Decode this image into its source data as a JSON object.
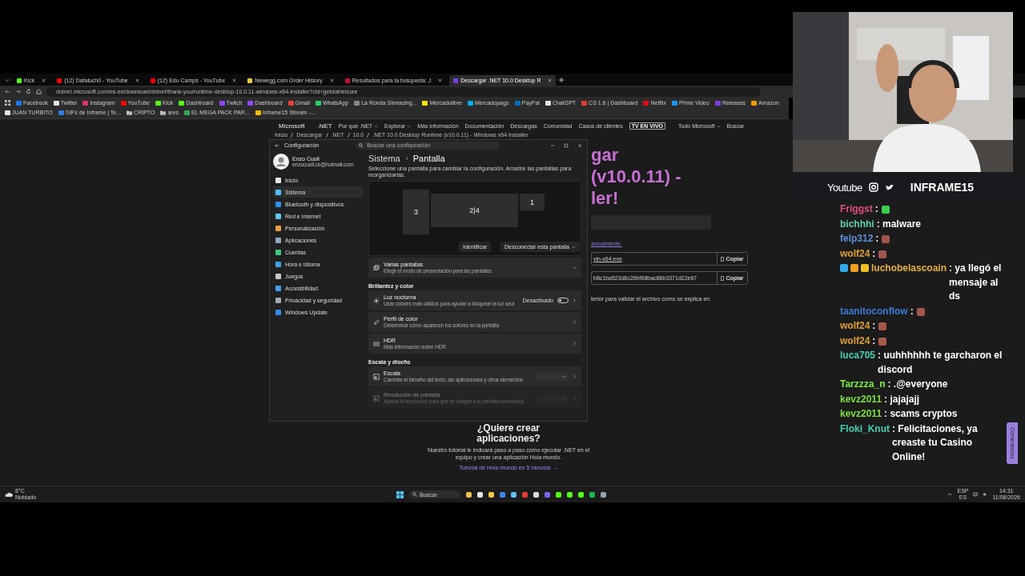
{
  "browser": {
    "tabs": [
      {
        "label": "Kick",
        "color": "#53fc18",
        "selected": false
      },
      {
        "label": "(12) Dafaluch0 - YouTube",
        "color": "#ff0000",
        "selected": false
      },
      {
        "label": "(12) Edu Camps - YouTube",
        "color": "#ff0000",
        "selected": false
      },
      {
        "label": "Newegg.com Order History",
        "color": "#f7c948",
        "selected": false
      },
      {
        "label": "Resultados para la búsqueda: J",
        "color": "#c8102e",
        "selected": false
      },
      {
        "label": "Descargar .NET 10.0 Desktop R",
        "color": "#7b3fe4",
        "selected": true
      }
    ],
    "url": "dotnet.microsoft.com/es-es/download/dotnet/thank-you/runtime-desktop-10.0.11-windows-x64-installer?cid=getdotnetcore",
    "bookmarks": [
      {
        "label": "Facebook",
        "kind": "site",
        "color": "#1877f2"
      },
      {
        "label": "Twitter",
        "kind": "site",
        "color": "#e6e6e6"
      },
      {
        "label": "Instagram",
        "kind": "site",
        "color": "#e1306c"
      },
      {
        "label": "YouTube",
        "kind": "site",
        "color": "#ff0000"
      },
      {
        "label": "Kick",
        "kind": "site",
        "color": "#53fc18"
      },
      {
        "label": "Dashboard",
        "kind": "site",
        "color": "#53fc18"
      },
      {
        "label": "Twitch",
        "kind": "site",
        "color": "#9146ff"
      },
      {
        "label": "Dashboard",
        "kind": "site",
        "color": "#9146ff"
      },
      {
        "label": "Gmail",
        "kind": "site",
        "color": "#ea4335"
      },
      {
        "label": "WhatsApp",
        "kind": "site",
        "color": "#25d366"
      },
      {
        "label": "La Ronda Simracing...",
        "kind": "site",
        "color": "#888888"
      },
      {
        "label": "Mercadolibre",
        "kind": "site",
        "color": "#ffe600"
      },
      {
        "label": "Mercadopago",
        "kind": "site",
        "color": "#00b1ea"
      },
      {
        "label": "PayPal",
        "kind": "site",
        "color": "#0070ba"
      },
      {
        "label": "ChatGPT",
        "kind": "site",
        "color": "#e6e6e6"
      },
      {
        "label": "CS 1.6 | Dashboard",
        "kind": "site",
        "color": "#e53935"
      },
      {
        "label": "Netflix",
        "kind": "site",
        "color": "#e50914"
      },
      {
        "label": "Prime Video",
        "kind": "site",
        "color": "#1a98ff"
      },
      {
        "label": "Releases",
        "kind": "site",
        "color": "#7b3fe4"
      },
      {
        "label": "Amazon",
        "kind": "site",
        "color": "#ff9900"
      },
      {
        "label": "JUAN TURBITO",
        "kind": "site",
        "color": "#e6e6e6"
      },
      {
        "label": "GIFs de Inframe | Te...",
        "kind": "site",
        "color": "#2b7de9"
      },
      {
        "label": "CRIPTO",
        "kind": "folder",
        "color": "#bbbbbb"
      },
      {
        "label": "ares",
        "kind": "folder",
        "color": "#bbbbbb"
      },
      {
        "label": "EL MEGA PACK PAR...",
        "kind": "site",
        "color": "#34a853"
      },
      {
        "label": "Inframe15 Stream -...",
        "kind": "site",
        "color": "#fbbc04"
      }
    ]
  },
  "page": {
    "brand": "Microsoft",
    "product": ".NET",
    "nav": [
      {
        "label": "Por qué .NET",
        "dropdown": true
      },
      {
        "label": "Explorar",
        "dropdown": true
      },
      {
        "label": "Más información",
        "dropdown": false
      },
      {
        "label": "Documentación",
        "dropdown": false
      },
      {
        "label": "Descargas",
        "dropdown": false
      },
      {
        "label": "Comunidad",
        "dropdown": false
      },
      {
        "label": "Casos de clientes",
        "dropdown": false
      }
    ],
    "live_button": "TV EN VIVO",
    "all_microsoft": "Todo Microsoft",
    "search": "Buscar",
    "breadcrumb": [
      "Inicio",
      "Descargar",
      ".NET",
      "10.0",
      ".NET 10.0 Desktop Runtime (v10.0.11) - Windows x64 Installer"
    ],
    "title_lines": [
      "gar",
      "(v10.0.11) -",
      "ler!"
    ],
    "manual_link": "anualmente.",
    "fields": [
      {
        "value": "vin-x64.exe",
        "link": true,
        "button": "Copiar"
      },
      {
        "value": "b8c1ba523d6c26bf68bac86b3371d22e67",
        "link": false,
        "button": "Copiar"
      }
    ],
    "note": "terior para validar el archivo como se explica en",
    "cta_title": [
      "¿Quiere crear",
      "aplicaciones?"
    ],
    "cta_text": "Nuestro tutorial le indicará paso a paso cómo ejecutar .NET en el equipo y crear una aplicación Hola mundo.",
    "cta_link": "Tutorial de Hola mundo en 5 minutos →"
  },
  "settings": {
    "title": "Configuración",
    "search_placeholder": "Buscar una configuración",
    "user": {
      "name": "Enzo Cuoli",
      "email": "enzocuoli.cs@hotmail.com"
    },
    "nav": [
      {
        "label": "Inicio",
        "color": "#e8e8e8",
        "selected": false
      },
      {
        "label": "Sistema",
        "color": "#4cc2ff",
        "selected": true
      },
      {
        "label": "Bluetooth y dispositivos",
        "color": "#2f8ee8",
        "selected": false
      },
      {
        "label": "Red e Internet",
        "color": "#60c8f0",
        "selected": false
      },
      {
        "label": "Personalización",
        "color": "#e8a040",
        "selected": false
      },
      {
        "label": "Aplicaciones",
        "color": "#8fa8c8",
        "selected": false
      },
      {
        "label": "Cuentas",
        "color": "#3cc87c",
        "selected": false
      },
      {
        "label": "Hora e idioma",
        "color": "#3aa0e8",
        "selected": false
      },
      {
        "label": "Juegos",
        "color": "#c8c8c8",
        "selected": false
      },
      {
        "label": "Accesibilidad",
        "color": "#3a9ff0",
        "selected": false
      },
      {
        "label": "Privacidad y seguridad",
        "color": "#a0a8b0",
        "selected": false
      },
      {
        "label": "Windows Update",
        "color": "#2f8ee8",
        "selected": false
      }
    ],
    "breadcrumb": [
      "Sistema",
      "Pantalla"
    ],
    "intro": "Seleccione una pantalla para cambiar la configuración. Arrastre las pantallas para reorganizarlas.",
    "monitors": [
      {
        "label": "3",
        "kind": "tall"
      },
      {
        "label": "2|4",
        "kind": "wide"
      },
      {
        "label": "1",
        "kind": "small"
      }
    ],
    "identify": "Identificar",
    "disconnect": "Desconectar esta pantalla",
    "rows": [
      {
        "kind": "expander",
        "title": "Varias pantallas",
        "subtitle": "Elegir el modo de presentación para las pantallas",
        "disabled": false
      },
      {
        "kind": "section",
        "title": "Brillantez y color"
      },
      {
        "kind": "toggle",
        "title": "Luz nocturna",
        "subtitle": "Usar colores más cálidos para ayudar a bloquear la luz azul",
        "state": "Desactivado",
        "on": false,
        "disabled": false
      },
      {
        "kind": "link",
        "title": "Perfil de color",
        "subtitle": "Determinar cómo aparecen los colores en la pantalla",
        "disabled": false
      },
      {
        "kind": "link",
        "title": "HDR",
        "subtitle": "Más información sobre HDR",
        "disabled": false
      },
      {
        "kind": "section",
        "title": "Escala y diseño"
      },
      {
        "kind": "dropdown",
        "title": "Escala",
        "subtitle": "Cambiar el tamaño del texto, las aplicaciones y otros elementos",
        "disabled": false
      },
      {
        "kind": "dropdown",
        "title": "Resolución de pantalla",
        "subtitle": "Ajustar la resolución para que se adapte a la pantalla conectada",
        "disabled": true
      }
    ]
  },
  "taskbar": {
    "weather": {
      "temp": "8°C",
      "text": "Nublado"
    },
    "search": "Buscar",
    "apps": [
      {
        "color": "#f2c14e"
      },
      {
        "color": "#e6e6e6"
      },
      {
        "color": "#f5c542"
      },
      {
        "color": "#4285f4"
      },
      {
        "color": "#66c0f4"
      },
      {
        "color": "#e53935"
      },
      {
        "color": "#dddddd"
      },
      {
        "color": "#7b68ee"
      },
      {
        "color": "#53fc18"
      },
      {
        "color": "#53fc18"
      },
      {
        "color": "#53fc18"
      },
      {
        "color": "#1db954"
      },
      {
        "color": "#9aa4b0"
      }
    ],
    "lang": [
      "ESP",
      "ES"
    ],
    "time": "14:31",
    "date": "11/08/2026"
  },
  "stream": {
    "socials": [
      "Youtube"
    ],
    "handle": "INFRAME15",
    "chat": [
      {
        "user": "Friggst",
        "color": "#e0507a",
        "text": ":",
        "emote": {
          "color": "#3ccf4e"
        }
      },
      {
        "user": "bichhhi",
        "color": "#5fd3b0",
        "text": ": malware"
      },
      {
        "user": "felp312",
        "color": "#5a8fd8",
        "text": ":",
        "emote": {
          "color": "#a0524a"
        }
      },
      {
        "user": "wolf24",
        "color": "#e0a030",
        "text": ":",
        "emote": {
          "color": "#a25450"
        }
      },
      {
        "user": "luchobelascoain",
        "color": "#e0b040",
        "text": ": ya llegó el mensaje al ds",
        "badges": [
          {
            "color": "#2fa8e8"
          },
          {
            "color": "#f0a020"
          },
          {
            "color": "#f0c020"
          }
        ]
      },
      {
        "user": "taanitoconflow",
        "color": "#3a7ad8",
        "text": ":",
        "emote": {
          "color": "#a4564c"
        }
      },
      {
        "user": "wolf24",
        "color": "#e0a030",
        "text": ":",
        "emote": {
          "color": "#a65848"
        }
      },
      {
        "user": "wolf24",
        "color": "#e0a030",
        "text": ":",
        "emote": {
          "color": "#a85a4a"
        }
      },
      {
        "user": "luca705",
        "color": "#40d0b0",
        "text": ": uuhhhhhh te garcharon el discord"
      },
      {
        "user": "Tarzzza_n",
        "color": "#7cf040",
        "text": ": .@everyone"
      },
      {
        "user": "kevz2011",
        "color": "#7ce040",
        "text": ": jajajajj"
      },
      {
        "user": "kevz2011",
        "color": "#7ce040",
        "text": ": scams cryptos"
      },
      {
        "user": "Floki_Knut",
        "color": "#40d0b0",
        "text": ": Felicitaciones, ya creaste tu Casino Online!"
      }
    ],
    "comments_tab": "Comentarios"
  }
}
